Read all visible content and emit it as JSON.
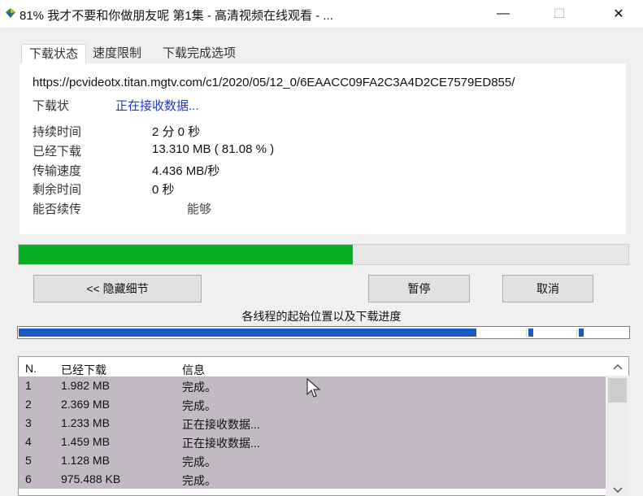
{
  "window": {
    "title": "81% 我才不要和你做朋友呢 第1集 - 高清视频在线观看 - ...",
    "min_glyph": "—",
    "max_glyph": "☐",
    "close_glyph": "✕"
  },
  "tabs": [
    {
      "label": "下载状态",
      "active": true
    },
    {
      "label": "速度限制",
      "active": false
    },
    {
      "label": "下载完成选项",
      "active": false
    }
  ],
  "status_panel": {
    "url": "https://pcvideotx.titan.mgtv.com/c1/2020/05/12_0/6EAACC09FA2C3A4D2CE7579ED855/",
    "status_label": "下载状",
    "status_value": "正在接收数据...",
    "fields": [
      {
        "label": "持续时间",
        "value": "2 分 0 秒"
      },
      {
        "label": "已经下载",
        "value": "13.310  MB  ( 81.08 % )"
      },
      {
        "label": "传输速度",
        "value": "4.436  MB/秒"
      },
      {
        "label": "剩余时间",
        "value": "0 秒"
      },
      {
        "label": "能否续传",
        "value": "能够"
      }
    ]
  },
  "progress": {
    "fraction": 0.5486,
    "color": "#06b025"
  },
  "buttons": {
    "hide_details": "<< 隐藏细节",
    "pause": "暂停",
    "cancel": "取消"
  },
  "threads_label": "各线程的起始位置以及下载进度",
  "segments": {
    "color": "#1a5bc4",
    "filled_fraction": 0.751,
    "ticks": [
      0.836,
      0.919
    ]
  },
  "connections": {
    "columns": [
      "N.",
      "已经下载",
      "信息"
    ],
    "rows": [
      [
        "1",
        "1.982  MB",
        "完成。"
      ],
      [
        "2",
        "2.369  MB",
        "完成。"
      ],
      [
        "3",
        "1.233  MB",
        "正在接收数据..."
      ],
      [
        "4",
        "1.459  MB",
        "正在接收数据..."
      ],
      [
        "5",
        "1.128  MB",
        "完成。"
      ],
      [
        "6",
        "975.488  KB",
        "完成。"
      ]
    ],
    "row_color": "#c3b9c5"
  },
  "icons": {
    "app": "app-icon",
    "scroll_up": "chevron-up-icon",
    "scroll_down": "chevron-down-icon",
    "cursor": "mouse-cursor-icon"
  }
}
